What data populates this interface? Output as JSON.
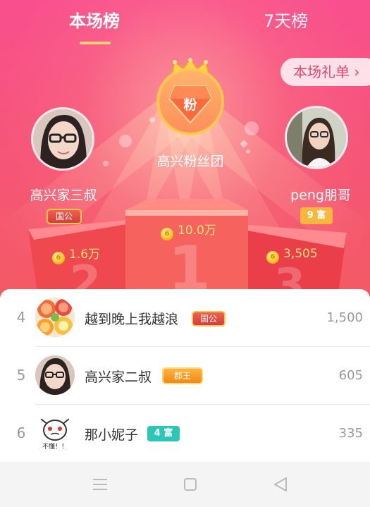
{
  "tabs": {
    "current": "本场榜",
    "week": "7天榜"
  },
  "gift_list_button": "本场礼单 ›",
  "first_place": {
    "badge_char": "粉",
    "name": "高兴粉丝团",
    "score": "10.0万",
    "podium_number": "1"
  },
  "second_place": {
    "name": "高兴家三叔",
    "badge": "国公",
    "score": "1.6万",
    "podium_number": "2"
  },
  "third_place": {
    "name": "peng朋哥",
    "badge": "9 富",
    "score": "3,505",
    "podium_number": "3"
  },
  "ranking": [
    {
      "rank": "4",
      "name": "越到晚上我越浪",
      "badge": "国公",
      "value": "1,500"
    },
    {
      "rank": "5",
      "name": "高兴家二叔",
      "badge": "郡王",
      "value": "605"
    },
    {
      "rank": "6",
      "name": "那小妮子",
      "badge": "4 富",
      "value": "335"
    }
  ],
  "avatar_caption_row6": "不懂！！",
  "colors": {
    "hero_top": "#f94f8e",
    "hero_bottom": "#f45a63",
    "gold": "#ffc94d",
    "score_text": "#ffe27a",
    "fu_badge": "#f7b73d",
    "fu4_badge": "#2bc7b6"
  },
  "icons": {
    "nav_menu": "menu-icon",
    "nav_home": "home-square-icon",
    "nav_back": "back-triangle-icon",
    "coin": "coin-icon",
    "crown": "crown-icon"
  }
}
